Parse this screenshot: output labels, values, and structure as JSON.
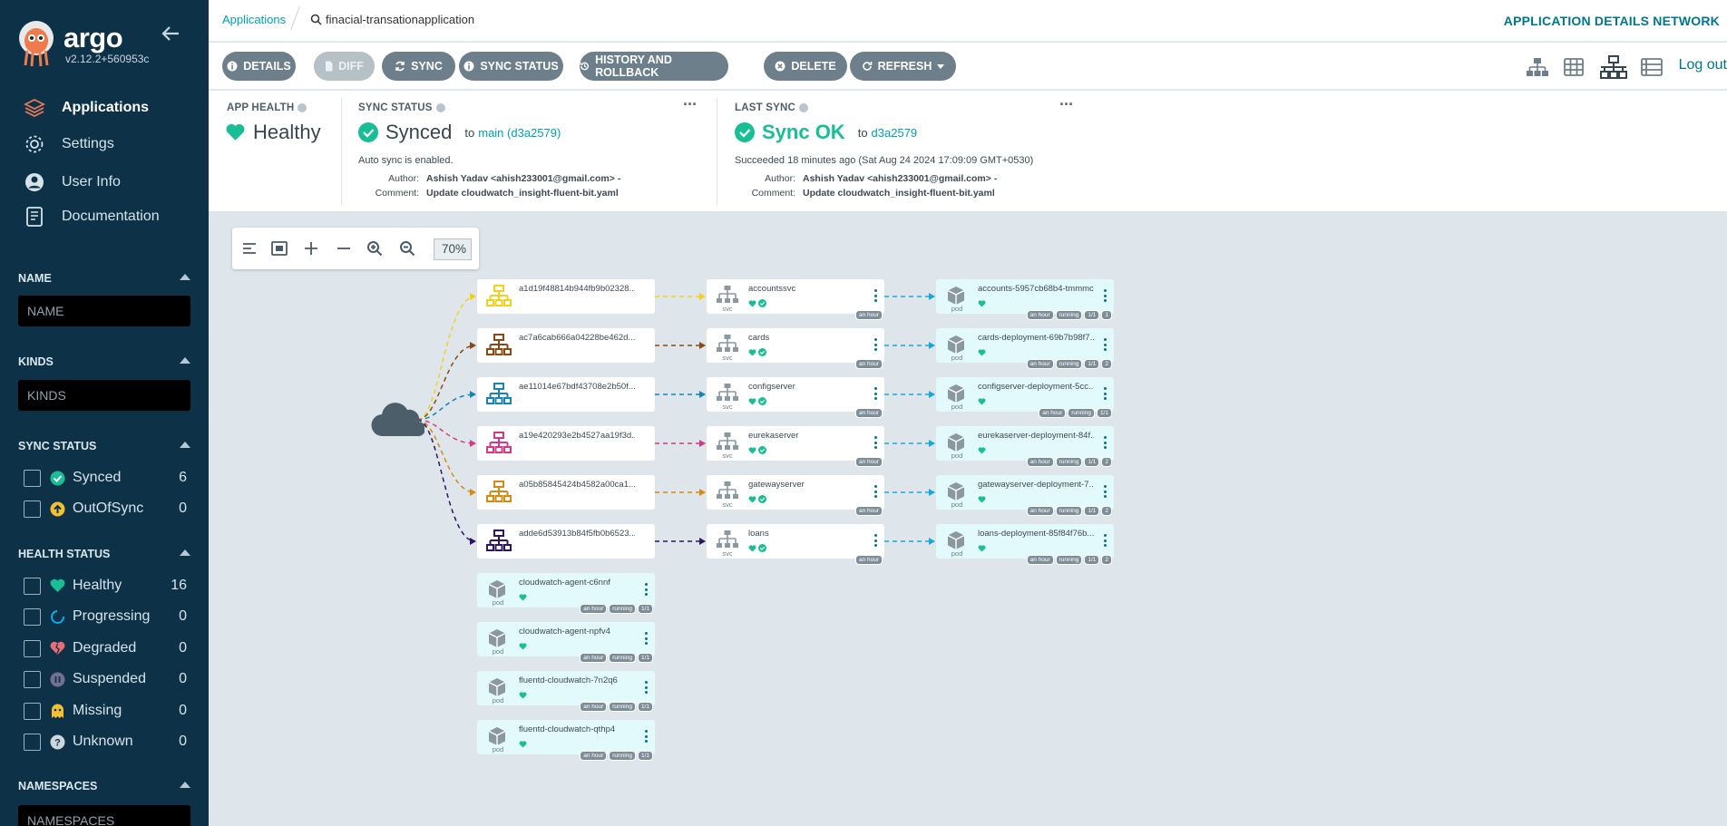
{
  "sidebar": {
    "brand": "argo",
    "version": "v2.12.2+560953c",
    "nav": [
      {
        "label": "Applications",
        "icon": "layers-icon"
      },
      {
        "label": "Settings",
        "icon": "gear-icon"
      },
      {
        "label": "User Info",
        "icon": "user-icon"
      },
      {
        "label": "Documentation",
        "icon": "book-icon"
      }
    ],
    "name_filter": {
      "title": "NAME",
      "placeholder": "NAME"
    },
    "kinds_filter": {
      "title": "KINDS",
      "placeholder": "KINDS"
    },
    "sync_status": {
      "title": "SYNC STATUS",
      "items": [
        {
          "label": "Synced",
          "count": "6",
          "color": "#18be94"
        },
        {
          "label": "OutOfSync",
          "count": "0",
          "color": "#f4c030"
        }
      ]
    },
    "health_status": {
      "title": "HEALTH STATUS",
      "items": [
        {
          "label": "Healthy",
          "count": "16",
          "color": "#18be94"
        },
        {
          "label": "Progressing",
          "count": "0",
          "color": "#0dadea"
        },
        {
          "label": "Degraded",
          "count": "0",
          "color": "#e96d76"
        },
        {
          "label": "Suspended",
          "count": "0",
          "color": "#766f94"
        },
        {
          "label": "Missing",
          "count": "0",
          "color": "#f4c030"
        },
        {
          "label": "Unknown",
          "count": "0",
          "color": "#ccd6dd"
        }
      ]
    },
    "namespaces_filter": {
      "title": "NAMESPACES",
      "placeholder": "NAMESPACES"
    }
  },
  "topbar": {
    "breadcrumb": "Applications",
    "app_name": "finacial-transationapplication",
    "title": "APPLICATION DETAILS NETWORK"
  },
  "toolbar": {
    "buttons": [
      {
        "label": "DETAILS",
        "icon": "info-icon"
      },
      {
        "label": "DIFF",
        "icon": "file-icon"
      },
      {
        "label": "SYNC",
        "icon": "sync-icon"
      },
      {
        "label": "SYNC STATUS",
        "icon": "info-icon"
      },
      {
        "label": "HISTORY AND ROLLBACK",
        "icon": "history-icon"
      },
      {
        "label": "DELETE",
        "icon": "delete-icon"
      },
      {
        "label": "REFRESH",
        "icon": "refresh-icon"
      }
    ],
    "logout": "Log out"
  },
  "status": {
    "app_health": {
      "label": "APP HEALTH",
      "value": "Healthy"
    },
    "sync_status": {
      "label": "SYNC STATUS",
      "value": "Synced",
      "to": "to",
      "revision": "main (d3a2579)",
      "auto": "Auto sync is enabled.",
      "author_label": "Author:",
      "author": "Ashish Yadav <ahish233001@gmail.com> -",
      "comment_label": "Comment:",
      "comment": "Update cloudwatch_insight-fluent-bit.yaml"
    },
    "last_sync": {
      "label": "LAST SYNC",
      "value": "Sync OK",
      "to": "to",
      "revision": "d3a2579",
      "succeeded": "Succeeded 18 minutes ago (Sat Aug 24 2024 17:09:09 GMT+0530)",
      "author_label": "Author:",
      "author": "Ashish Yadav <ahish233001@gmail.com> -",
      "comment_label": "Comment:",
      "comment": "Update cloudwatch_insight-fluent-bit.yaml"
    }
  },
  "zoom": {
    "value": "70%"
  },
  "graph": {
    "kind_labels": {
      "svc": "svc",
      "pod": "pod"
    },
    "ingress": [
      {
        "name": "a1d19f48814b944fb9b02328...",
        "color": "#f2d01b"
      },
      {
        "name": "ac7a6cab666a04228be462d...",
        "color": "#8a4a12"
      },
      {
        "name": "ae11014e67bdf43708e2b50f...",
        "color": "#1583b5"
      },
      {
        "name": "a19e420293e2b4527aa19f3d...",
        "color": "#d23a86"
      },
      {
        "name": "a05b85845424b4582a00ca1...",
        "color": "#d68a12"
      },
      {
        "name": "adde6d53913b84f5fb0b6523...",
        "color": "#2f1560"
      }
    ],
    "services": [
      {
        "name": "accountssvc",
        "tags": [
          "an hour"
        ]
      },
      {
        "name": "cards",
        "tags": [
          "an hour"
        ]
      },
      {
        "name": "configserver",
        "tags": [
          "an hour"
        ]
      },
      {
        "name": "eurekaserver",
        "tags": [
          "an hour"
        ]
      },
      {
        "name": "gatewayserver",
        "tags": [
          "an hour"
        ]
      },
      {
        "name": "loans",
        "tags": [
          "an hour"
        ]
      }
    ],
    "pods": [
      {
        "name": "accounts-5957cb68b4-tmmmc",
        "tags": [
          "an hour",
          "running",
          "1/1",
          "1"
        ]
      },
      {
        "name": "cards-deployment-69b7b98f7...",
        "tags": [
          "an hour",
          "running",
          "1/1",
          "2"
        ]
      },
      {
        "name": "configserver-deployment-5cc...",
        "tags": [
          "an hour",
          "running",
          "1/1"
        ]
      },
      {
        "name": "eurekaserver-deployment-84f...",
        "tags": [
          "an hour",
          "running",
          "1/1",
          "2"
        ]
      },
      {
        "name": "gatewayserver-deployment-7...",
        "tags": [
          "an hour",
          "running",
          "1/1",
          "2"
        ]
      },
      {
        "name": "loans-deployment-85f84f76b...",
        "tags": [
          "an hour",
          "running",
          "1/1",
          "2"
        ]
      }
    ],
    "standalone_pods": [
      {
        "name": "cloudwatch-agent-c6nnf",
        "tags": [
          "an hour",
          "running",
          "1/1"
        ]
      },
      {
        "name": "cloudwatch-agent-npfv4",
        "tags": [
          "an hour",
          "running",
          "1/1"
        ]
      },
      {
        "name": "fluentd-cloudwatch-7n2q6",
        "tags": [
          "an hour",
          "running",
          "1/1"
        ]
      },
      {
        "name": "fluentd-cloudwatch-qthp4",
        "tags": [
          "an hour",
          "running",
          "1/1"
        ]
      }
    ]
  }
}
